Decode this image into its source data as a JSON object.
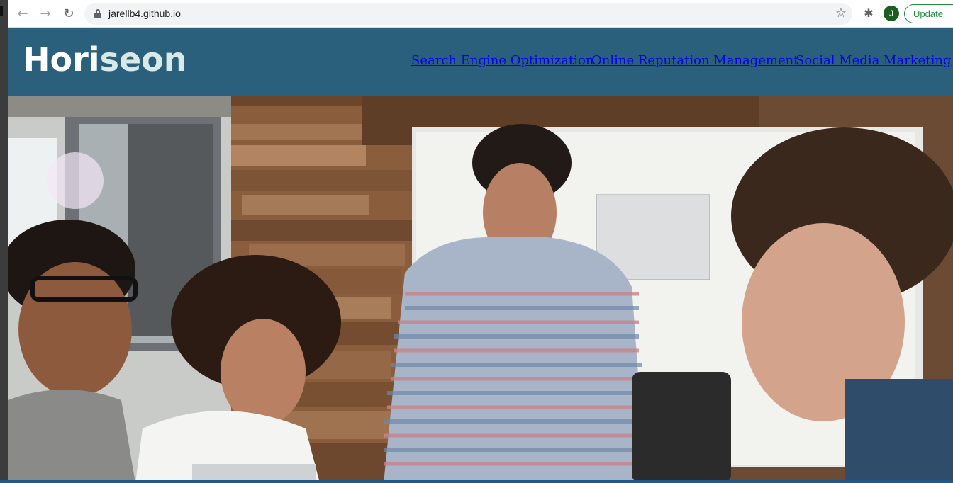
{
  "browser": {
    "url": "jarellb4.github.io",
    "profile_initial": "J",
    "update_label": "Update",
    "icons": [
      "back-arrow-icon",
      "forward-arrow-icon",
      "reload-icon",
      "lock-icon",
      "star-icon",
      "puzzle-icon"
    ]
  },
  "site": {
    "logo_part1": "Hori",
    "logo_part2": "seon",
    "nav": [
      {
        "label": "Search Engine Optimization"
      },
      {
        "label": "Online Reputation Management"
      },
      {
        "label": "Social Media Marketing"
      }
    ],
    "colors": {
      "header_bg": "#2a607c",
      "logo_white": "#ffffff",
      "logo_accent": "#d9e9e8",
      "link": "#0000ee"
    }
  },
  "hero": {
    "image_icon": "hero-photo-icon"
  }
}
